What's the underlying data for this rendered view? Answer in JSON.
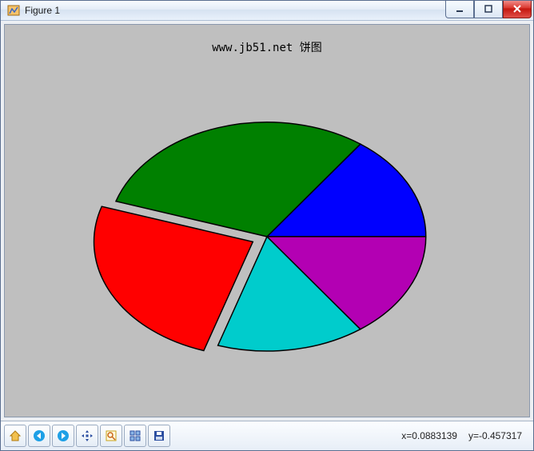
{
  "window": {
    "title": "Figure 1"
  },
  "chart_data": {
    "type": "pie",
    "title": "www.jb51.net 饼图",
    "slices": [
      {
        "label": "",
        "value": 15,
        "color": "#0000ff",
        "explode": 0
      },
      {
        "label": "",
        "value": 30,
        "color": "#008000",
        "explode": 0
      },
      {
        "label": "",
        "value": 25,
        "color": "#ff0000",
        "explode": 0.1
      },
      {
        "label": "",
        "value": 15,
        "color": "#00cccc",
        "explode": 0
      },
      {
        "label": "",
        "value": 15,
        "color": "#b300b3",
        "explode": 0
      }
    ],
    "start_angle_deg": 0,
    "direction": "ccw",
    "aspect": 0.72
  },
  "status": {
    "x_label": "x=0.0883139",
    "y_label": "y=-0.457317"
  },
  "toolbar": {
    "home": "Home",
    "back": "Back",
    "forward": "Forward",
    "pan": "Pan",
    "zoom": "Zoom",
    "subplots": "Subplots",
    "save": "Save"
  }
}
